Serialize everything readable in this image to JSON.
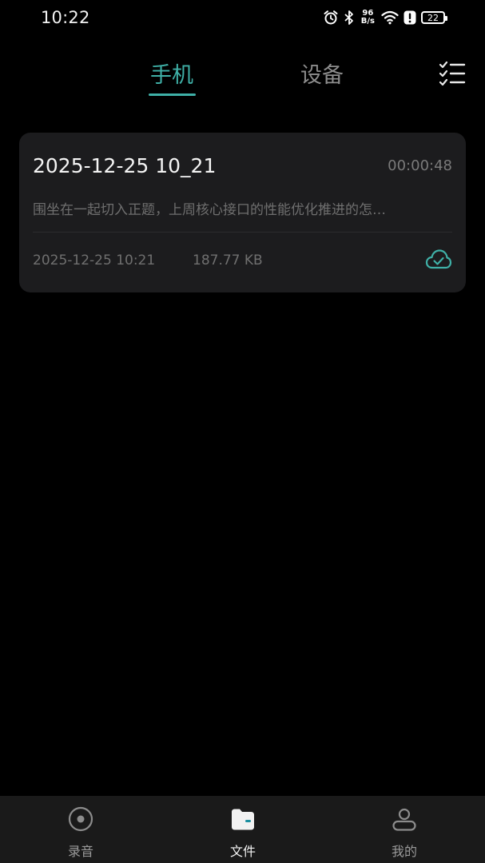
{
  "status_bar": {
    "time": "10:22",
    "net_speed_value": "96",
    "net_speed_unit": "B/s",
    "battery": "22",
    "icons": [
      "alarm-icon",
      "bluetooth-icon",
      "wifi-icon",
      "alert-icon",
      "battery-icon"
    ]
  },
  "tabs": [
    {
      "label": "手机",
      "active": true
    },
    {
      "label": "设备",
      "active": false
    }
  ],
  "toolbar": {
    "list_toggle_icon": "checklist-icon"
  },
  "recordings": [
    {
      "title": "2025-12-25 10_21",
      "duration": "00:00:48",
      "summary": "围坐在一起切入正题，上周核心接口的性能优化推进的怎…",
      "date": "2025-12-25 10:21",
      "size": "187.77 KB",
      "status_icon": "cloud-check-icon"
    }
  ],
  "bottom_nav": [
    {
      "label": "录音",
      "icon": "record-icon",
      "active": false
    },
    {
      "label": "文件",
      "icon": "folder-icon",
      "active": true
    },
    {
      "label": "我的",
      "icon": "profile-icon",
      "active": false
    }
  ],
  "colors": {
    "accent": "#3fb0a7",
    "background": "#000000",
    "card": "#1c1c1e",
    "nav_bg": "#1a1a1a"
  }
}
